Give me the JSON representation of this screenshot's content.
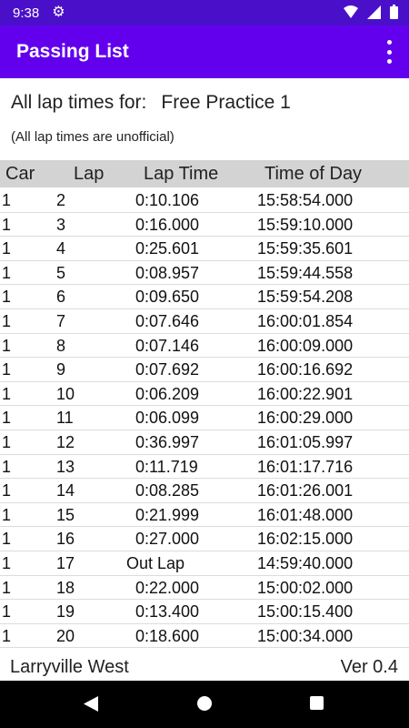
{
  "status_bar": {
    "time": "9:38",
    "icons": [
      "settings-icon",
      "wifi-icon",
      "signal-icon",
      "battery-icon"
    ]
  },
  "app_bar": {
    "title": "Passing List",
    "menu_icon": "overflow-menu-icon"
  },
  "heading": {
    "label": "All lap times for:",
    "session": "Free Practice 1"
  },
  "note": "(All lap times are unofficial)",
  "columns": {
    "car": "Car",
    "lap": "Lap",
    "lap_time": "Lap Time",
    "time_of_day": "Time of Day"
  },
  "rows": [
    {
      "car": "1",
      "lap": "2",
      "lap_time": "0:10.106",
      "time_of_day": "15:58:54.000"
    },
    {
      "car": "1",
      "lap": "3",
      "lap_time": "0:16.000",
      "time_of_day": "15:59:10.000"
    },
    {
      "car": "1",
      "lap": "4",
      "lap_time": "0:25.601",
      "time_of_day": "15:59:35.601"
    },
    {
      "car": "1",
      "lap": "5",
      "lap_time": "0:08.957",
      "time_of_day": "15:59:44.558"
    },
    {
      "car": "1",
      "lap": "6",
      "lap_time": "0:09.650",
      "time_of_day": "15:59:54.208"
    },
    {
      "car": "1",
      "lap": "7",
      "lap_time": "0:07.646",
      "time_of_day": "16:00:01.854"
    },
    {
      "car": "1",
      "lap": "8",
      "lap_time": "0:07.146",
      "time_of_day": "16:00:09.000"
    },
    {
      "car": "1",
      "lap": "9",
      "lap_time": "0:07.692",
      "time_of_day": "16:00:16.692"
    },
    {
      "car": "1",
      "lap": "10",
      "lap_time": "0:06.209",
      "time_of_day": "16:00:22.901"
    },
    {
      "car": "1",
      "lap": "11",
      "lap_time": "0:06.099",
      "time_of_day": "16:00:29.000"
    },
    {
      "car": "1",
      "lap": "12",
      "lap_time": "0:36.997",
      "time_of_day": "16:01:05.997"
    },
    {
      "car": "1",
      "lap": "13",
      "lap_time": "0:11.719",
      "time_of_day": "16:01:17.716"
    },
    {
      "car": "1",
      "lap": "14",
      "lap_time": "0:08.285",
      "time_of_day": "16:01:26.001"
    },
    {
      "car": "1",
      "lap": "15",
      "lap_time": "0:21.999",
      "time_of_day": "16:01:48.000"
    },
    {
      "car": "1",
      "lap": "16",
      "lap_time": "0:27.000",
      "time_of_day": "16:02:15.000"
    },
    {
      "car": "1",
      "lap": "17",
      "lap_time": "Out Lap",
      "time_of_day": "14:59:40.000"
    },
    {
      "car": "1",
      "lap": "18",
      "lap_time": "0:22.000",
      "time_of_day": "15:00:02.000"
    },
    {
      "car": "1",
      "lap": "19",
      "lap_time": "0:13.400",
      "time_of_day": "15:00:15.400"
    },
    {
      "car": "1",
      "lap": "20",
      "lap_time": "0:18.600",
      "time_of_day": "15:00:34.000"
    }
  ],
  "footer": {
    "track": "Larryville West",
    "version": "Ver 0.4"
  },
  "nav_bar": {
    "icons": [
      "back-icon",
      "home-icon",
      "recents-icon"
    ]
  },
  "colors": {
    "status_bar": "#4a10c9",
    "app_bar": "#6200ee",
    "header_bg": "#d3d3d3"
  }
}
